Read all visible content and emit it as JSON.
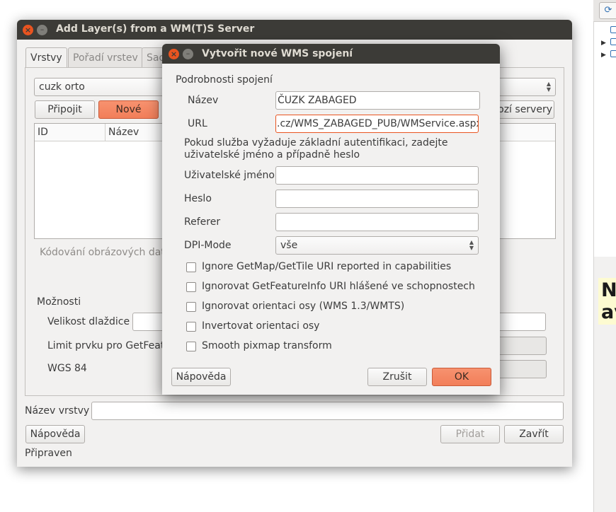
{
  "main_window": {
    "title": "Add Layer(s) from a WM(T)S Server",
    "tabs": [
      "Vrstvy",
      "Pořadí vrstev",
      "Sad"
    ],
    "connection_combo": "cuzk orto",
    "buttons": {
      "connect": "Připojit",
      "new": "Nové",
      "load_servers": "ozí servery"
    },
    "table_headers": [
      "ID",
      "Název"
    ],
    "image_encoding_label": "Kódování obrázových dat",
    "options": {
      "title": "Možnosti",
      "tile_size": "Velikost dlaždice",
      "feature_limit": "Limit prvku pro GetFeatu",
      "crs": "WGS 84"
    },
    "layer_name_label": "Název vrstvy",
    "help_button": "Nápověda",
    "add_button": "Přidat",
    "close_button": "Zavřít",
    "status": "Připraven"
  },
  "dialog": {
    "title": "Vytvořit nové WMS spojení",
    "group_title": "Podrobnosti spojení",
    "name_label": "Název",
    "name_value": "ČUZK ZABAGED",
    "url_label": "URL",
    "url_value": ".cz/WMS_ZABAGED_PUB/WMService.aspx",
    "auth_note": "Pokud služba vyžaduje základní autentifikaci, zadejte uživatelské jméno a případně heslo",
    "username_label": "Uživatelské jméno",
    "password_label": "Heslo",
    "referer_label": "Referer",
    "dpi_label": "DPI-Mode",
    "dpi_value": "vše",
    "checkboxes": [
      "Ignore GetMap/GetTile URI reported in capabilities",
      "Ignorovat GetFeatureInfo URI hlášené ve schopnostech",
      "Ignorovat orientaci osy (WMS 1.3/WMTS)",
      "Invertovat orientaci osy",
      "Smooth pixmap transform"
    ],
    "help_button": "Nápověda",
    "cancel_button": "Zrušit",
    "ok_button": "OK"
  },
  "background_panel": {
    "partial_text_line1": "Ne",
    "partial_text_line2": "av"
  },
  "colors": {
    "titlebar": "#3c3b37",
    "accent_orange": "#f27e59",
    "close_button": "#e95420"
  }
}
